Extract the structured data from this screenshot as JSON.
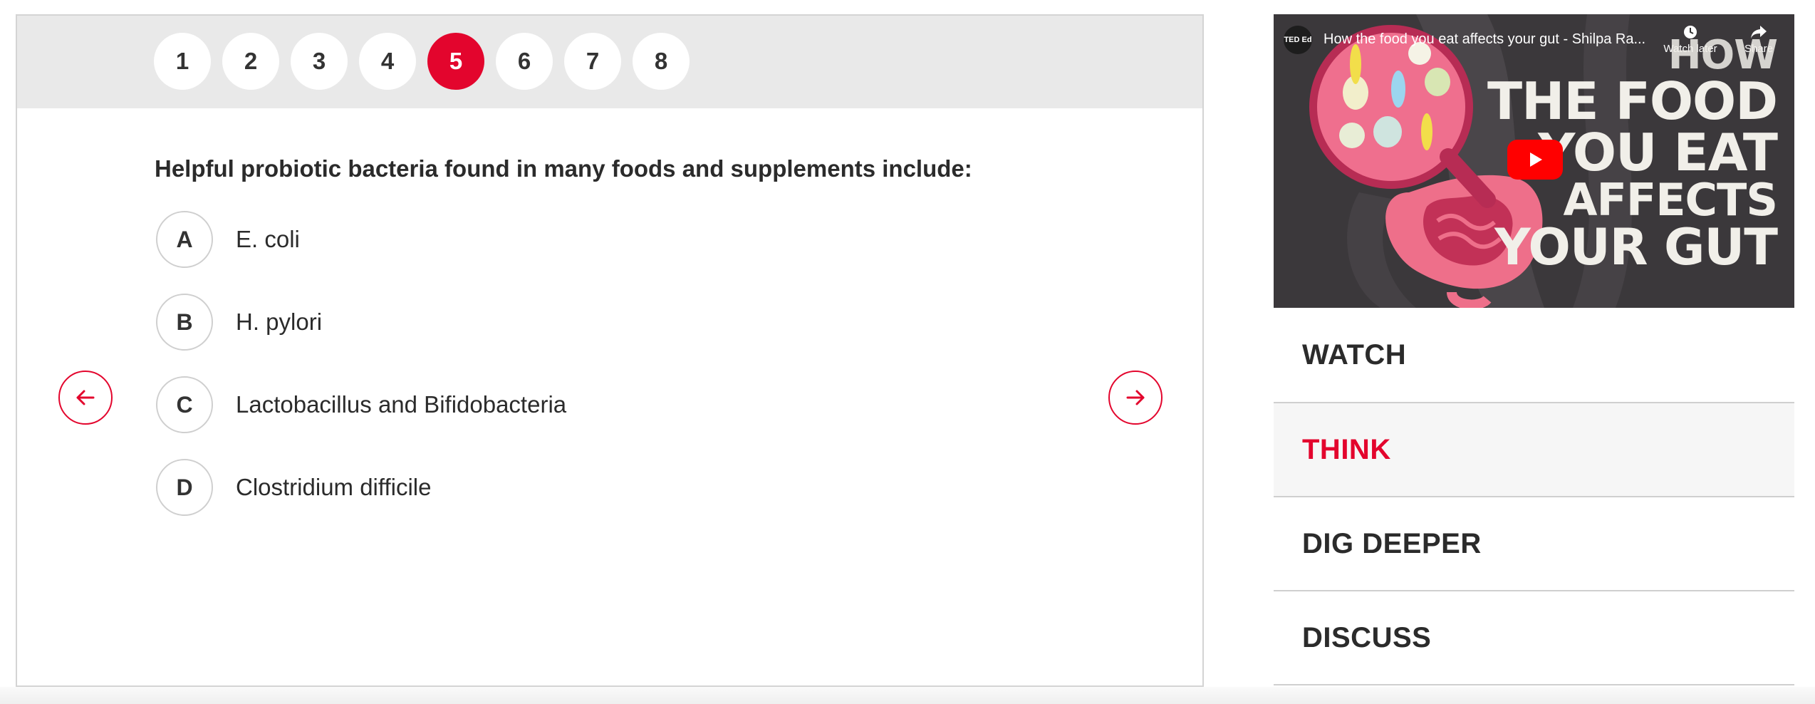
{
  "quiz": {
    "question_numbers": [
      "1",
      "2",
      "3",
      "4",
      "5",
      "6",
      "7",
      "8"
    ],
    "active_question": "5",
    "question": "Helpful probiotic bacteria found in many foods and supplements include:",
    "answers": [
      {
        "letter": "A",
        "text": "E. coli"
      },
      {
        "letter": "B",
        "text": "H. pylori"
      },
      {
        "letter": "C",
        "text": "Lactobacillus and Bifidobacteria"
      },
      {
        "letter": "D",
        "text": "Clostridium difficile"
      }
    ],
    "prev_icon": "arrow-left-icon",
    "next_icon": "arrow-right-icon"
  },
  "video": {
    "channel_logo_text": "TED Ed",
    "title": "How the food you eat affects your gut - Shilpa Ra...",
    "watch_later_label": "Watch later",
    "share_label": "Share",
    "overlay_lines": [
      "HOW",
      "THE FOOD",
      "YOU EAT",
      "AFFECTS",
      "YOUR GUT"
    ],
    "play_icon": "play-icon"
  },
  "tabs": [
    {
      "label": "WATCH",
      "active": false
    },
    {
      "label": "THINK",
      "active": true
    },
    {
      "label": "DIG DEEPER",
      "active": false
    },
    {
      "label": "DISCUSS",
      "active": false
    }
  ],
  "colors": {
    "accent": "#e3052d",
    "nav_bar_bg": "#e9e9e9",
    "text": "#2b2b2b",
    "youtube_red": "#ff0000"
  }
}
